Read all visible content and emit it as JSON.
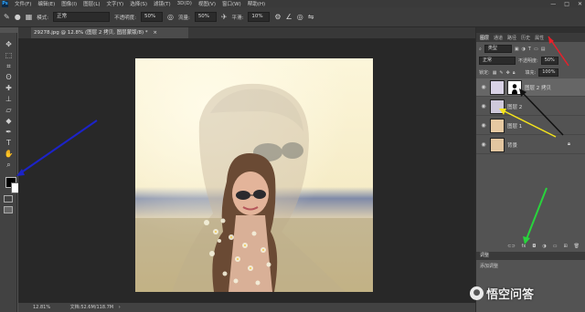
{
  "menubar": {
    "logo": "Ps",
    "items": [
      "文件(F)",
      "编辑(E)",
      "图像(I)",
      "图层(L)",
      "文字(Y)",
      "选择(S)",
      "滤镜(T)",
      "3D(D)",
      "视图(V)",
      "窗口(W)",
      "帮助(H)"
    ],
    "window_controls": [
      "—",
      "□",
      "✕"
    ]
  },
  "options": {
    "mode_label": "模式:",
    "mode_value": "正常",
    "opacity_label": "不透明度:",
    "opacity_value": "50%",
    "flow_label": "流量:",
    "flow_value": "50%",
    "smooth_label": "平滑:",
    "smooth_value": "10%"
  },
  "document": {
    "tab_title": "29278.jpg @ 12.8% (图层 2 拷贝, 图层蒙版/8) *",
    "tab_close": "×",
    "zoom": "12.81%",
    "doc_info": "文档:52.6M/118.7M"
  },
  "panel": {
    "tabs": [
      "图层",
      "通道",
      "路径",
      "历史",
      "属性"
    ],
    "active_tab": "图层",
    "kind_label": "类型",
    "blend_mode": "正常",
    "opacity_label": "不透明度:",
    "opacity_value": "50%",
    "lock_label": "锁定:",
    "fill_label": "填充:",
    "fill_value": "100%"
  },
  "layers": [
    {
      "name": "图层 2 拷贝",
      "selected": true,
      "has_mask": true
    },
    {
      "name": "图层 2",
      "selected": false,
      "has_mask": false
    },
    {
      "name": "图层 1",
      "selected": false,
      "has_mask": false
    },
    {
      "name": "背景",
      "selected": false,
      "has_mask": false,
      "locked": true
    }
  ],
  "adjustments": {
    "header": "调整",
    "sub": "添加调整"
  },
  "watermark": {
    "text": "悟空问答"
  },
  "colors": {
    "red_arrow": "#e8202a",
    "black_arrow": "#111111",
    "yellow_arrow": "#f4e31c",
    "green_arrow": "#28d43c",
    "blue_arrow": "#1c23c8"
  },
  "icons": [
    "brush-icon",
    "move-icon",
    "marquee-icon",
    "lasso-icon",
    "crop-icon",
    "eyedropper-icon",
    "healing-icon",
    "brush-tool-icon",
    "stamp-icon",
    "history-brush-icon",
    "eraser-icon",
    "gradient-icon",
    "blur-icon",
    "dodge-icon",
    "pen-icon",
    "type-icon",
    "path-select-icon",
    "shape-icon",
    "hand-icon",
    "zoom-icon",
    "eye-icon",
    "lock-icon",
    "mask-icon"
  ]
}
